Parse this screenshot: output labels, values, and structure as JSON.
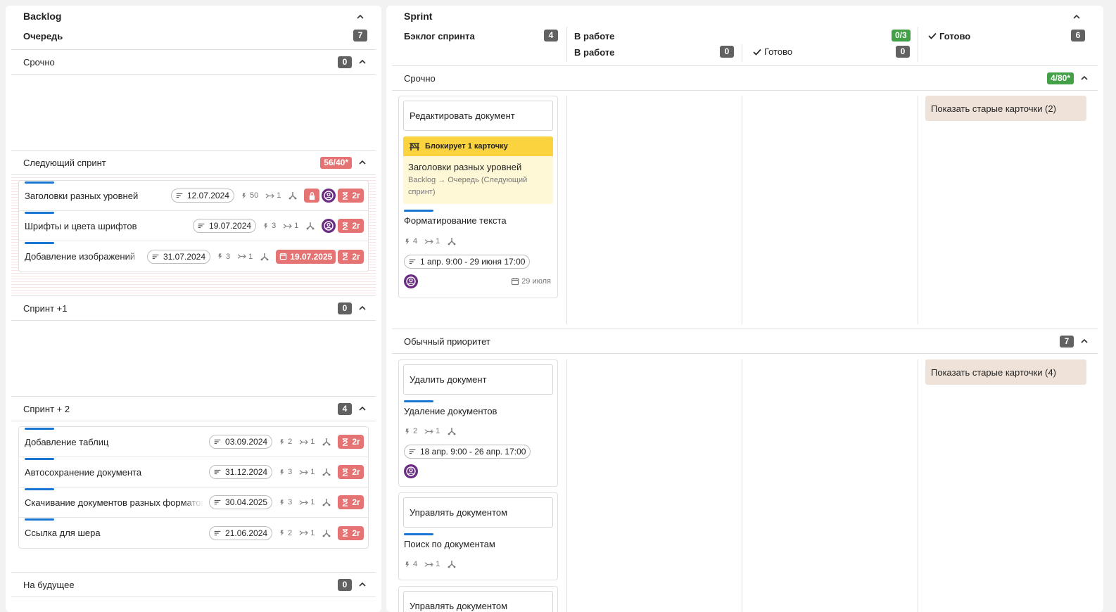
{
  "backlog": {
    "title": "Backlog",
    "queue_label": "Очередь",
    "queue_count": "7",
    "sections": [
      {
        "title": "Срочно",
        "count": "0"
      },
      {
        "title": "Следующий спринт",
        "count": "56/40*"
      },
      {
        "title": "Спринт +1",
        "count": "0"
      },
      {
        "title": "Спринт + 2",
        "count": "4"
      },
      {
        "title": "На будущее",
        "count": "0"
      }
    ],
    "next_sprint_tasks": [
      {
        "name": "Заголовки разных уровней",
        "date": "12.07.2024",
        "points": "50",
        "links": "1",
        "duration": "2г"
      },
      {
        "name": "Шрифты и цвета шрифтов",
        "date": "19.07.2024",
        "points": "3",
        "links": "1",
        "duration": "2г"
      },
      {
        "name": "Добавление изображений",
        "date": "31.07.2024",
        "points": "3",
        "links": "1",
        "deadline": "19.07.2025",
        "duration": "2г"
      }
    ],
    "sprint2_tasks": [
      {
        "name": "Добавление таблиц",
        "date": "03.09.2024",
        "points": "2",
        "links": "1",
        "duration": "2г"
      },
      {
        "name": "Автосохранение документа",
        "date": "31.12.2024",
        "points": "3",
        "links": "1",
        "duration": "2г"
      },
      {
        "name": "Скачивание документов разных форматов",
        "date": "30.04.2025",
        "points": "3",
        "links": "1",
        "duration": "2г"
      },
      {
        "name": "Ссылка для шера",
        "date": "21.06.2024",
        "points": "2",
        "links": "1",
        "duration": "2г"
      }
    ]
  },
  "sprint": {
    "title": "Sprint",
    "columns": {
      "backlog_label": "Бэклог спринта",
      "backlog_count": "4",
      "in_work_label": "В работе",
      "in_work_count": "0/3",
      "in_work_sub_label": "В работе",
      "in_work_sub_count": "0",
      "in_work_done_label": "Готово",
      "in_work_done_count": "0",
      "done_label": "Готово",
      "done_count": "6"
    },
    "urgent": {
      "title": "Срочно",
      "count": "4/80*",
      "story": "Редактировать документ",
      "blocker_label": "Блокирует 1 карточку",
      "blocker_title": "Заголовки разных уровней",
      "blocker_path": "Backlog → Очередь (Следующий спринт)",
      "task_name": "Форматирование текста",
      "task_points": "4",
      "task_links": "1",
      "task_dates": "1 апр. 9:00 - 29 июня 17:00",
      "task_due": "29 июля",
      "show_old": "Показать старые карточки (2)"
    },
    "normal": {
      "title": "Обычный приоритет",
      "count": "7",
      "card1_story": "Удалить документ",
      "card1_task": "Удаление документов",
      "card1_points": "2",
      "card1_links": "1",
      "card1_dates": "18 апр. 9:00 - 26 апр. 17:00",
      "card2_story": "Управлять документом",
      "card2_task": "Поиск по документам",
      "card2_points": "4",
      "card2_links": "1",
      "card3_story": "Управлять документом",
      "show_old": "Показать старые карточки (4)"
    }
  },
  "colors": {
    "accent_blue": "#1976d2",
    "red": "#e57373",
    "green": "#43a047",
    "purple": "#6a2c82",
    "yellow": "#fbd33f"
  }
}
